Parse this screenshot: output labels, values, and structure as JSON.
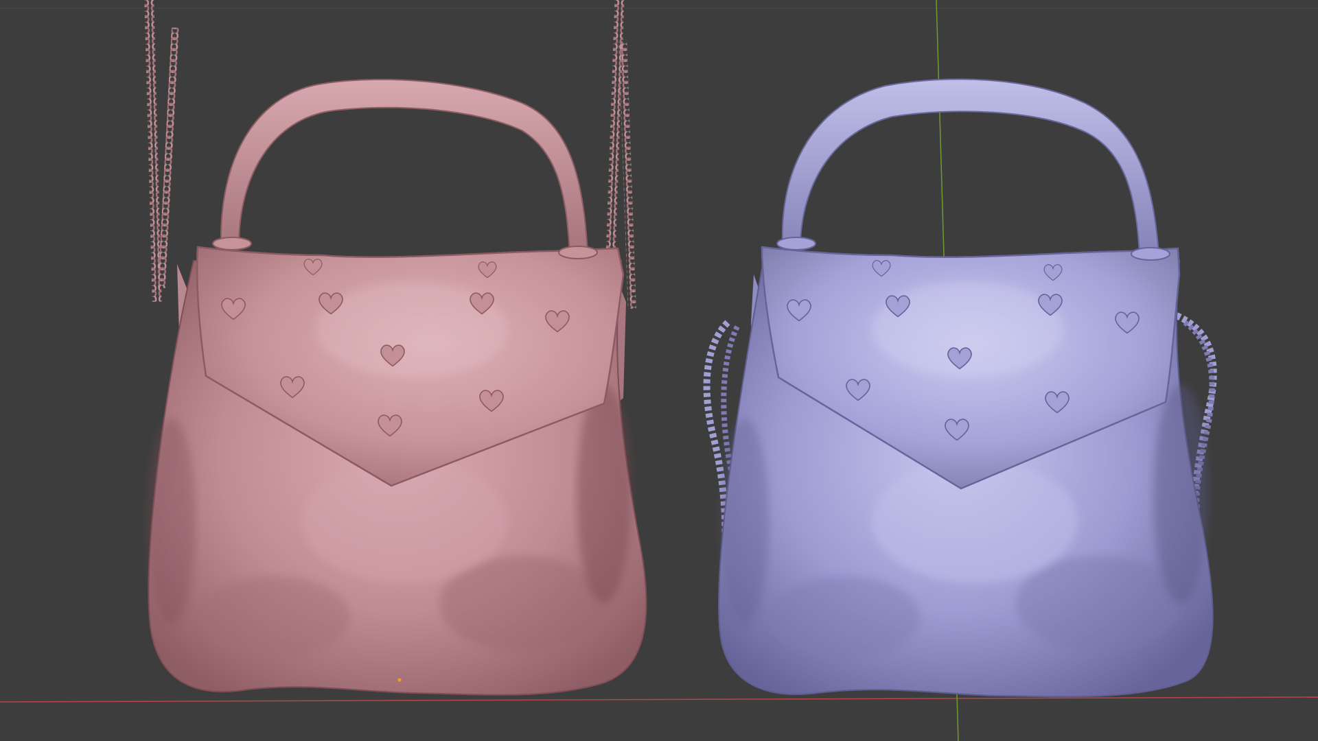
{
  "viewport": {
    "background": "#3d3d3d",
    "grid_line_color": "#4a4a4a",
    "x_axis_color": "#b5454a",
    "y_axis_color": "#6f9c2c",
    "origin_marker_color": "#f4a020"
  },
  "objects": [
    {
      "name": "handbag-pink",
      "base_color": "#c38f97",
      "shadow_color": "#6e4449",
      "highlight_color": "#dcb2b8",
      "hearts": 10,
      "strap": "chain-straight"
    },
    {
      "name": "handbag-lavender",
      "base_color": "#9c9ad0",
      "shadow_color": "#5a5884",
      "highlight_color": "#c3c2ea",
      "hearts": 10,
      "strap": "chain-draped"
    }
  ]
}
